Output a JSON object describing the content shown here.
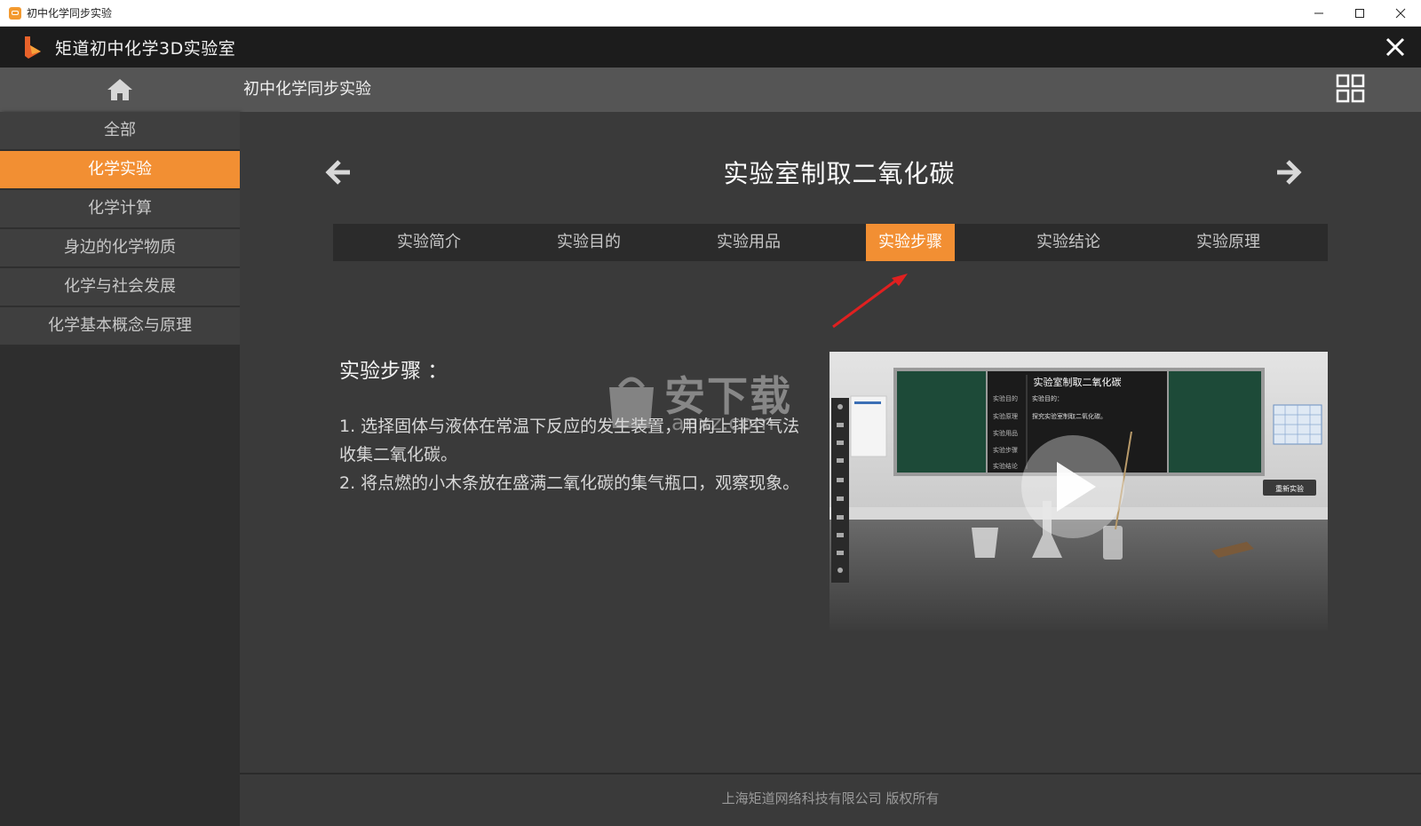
{
  "window": {
    "title": "初中化学同步实验",
    "controls": {
      "minimize": "—",
      "maximize": "☐",
      "close": "✕"
    }
  },
  "header": {
    "app_title": "矩道初中化学3D实验室"
  },
  "subbar": {
    "title": "初中化学同步实验"
  },
  "sidebar": {
    "items": [
      {
        "label": "全部",
        "active": false
      },
      {
        "label": "化学实验",
        "active": true
      },
      {
        "label": "化学计算",
        "active": false
      },
      {
        "label": "身边的化学物质",
        "active": false
      },
      {
        "label": "化学与社会发展",
        "active": false
      },
      {
        "label": "化学基本概念与原理",
        "active": false
      }
    ]
  },
  "experiment": {
    "title": "实验室制取二氧化碳",
    "tabs": [
      {
        "label": "实验简介",
        "active": false
      },
      {
        "label": "实验目的",
        "active": false
      },
      {
        "label": "实验用品",
        "active": false
      },
      {
        "label": "实验步骤",
        "active": true
      },
      {
        "label": "实验结论",
        "active": false
      },
      {
        "label": "实验原理",
        "active": false
      }
    ],
    "section_title": "实验步骤 ：",
    "steps": [
      "1. 选择固体与液体在常温下反应的发生装置，用向上排空气法收集二氧化碳。",
      "2. 将点燃的小木条放在盛满二氧化碳的集气瓶口，观察现象。"
    ]
  },
  "video": {
    "board_title": "实验室制取二氧化碳",
    "board_rows": [
      "实验目的",
      "实验原理",
      "实验用品",
      "实验步骤",
      "实验结论"
    ],
    "board_text_1": "实验目的：",
    "board_text_2": "探究实验室制取二氧化碳。",
    "restart_label": "重新实验"
  },
  "watermark": {
    "text": "安下载",
    "sub": "anxz.com"
  },
  "footer": {
    "copyright": "上海矩道网络科技有限公司 版权所有"
  },
  "colors": {
    "accent": "#f28f33",
    "header_bg": "#1c1c1c",
    "panel_bg": "#3a3a3a"
  }
}
